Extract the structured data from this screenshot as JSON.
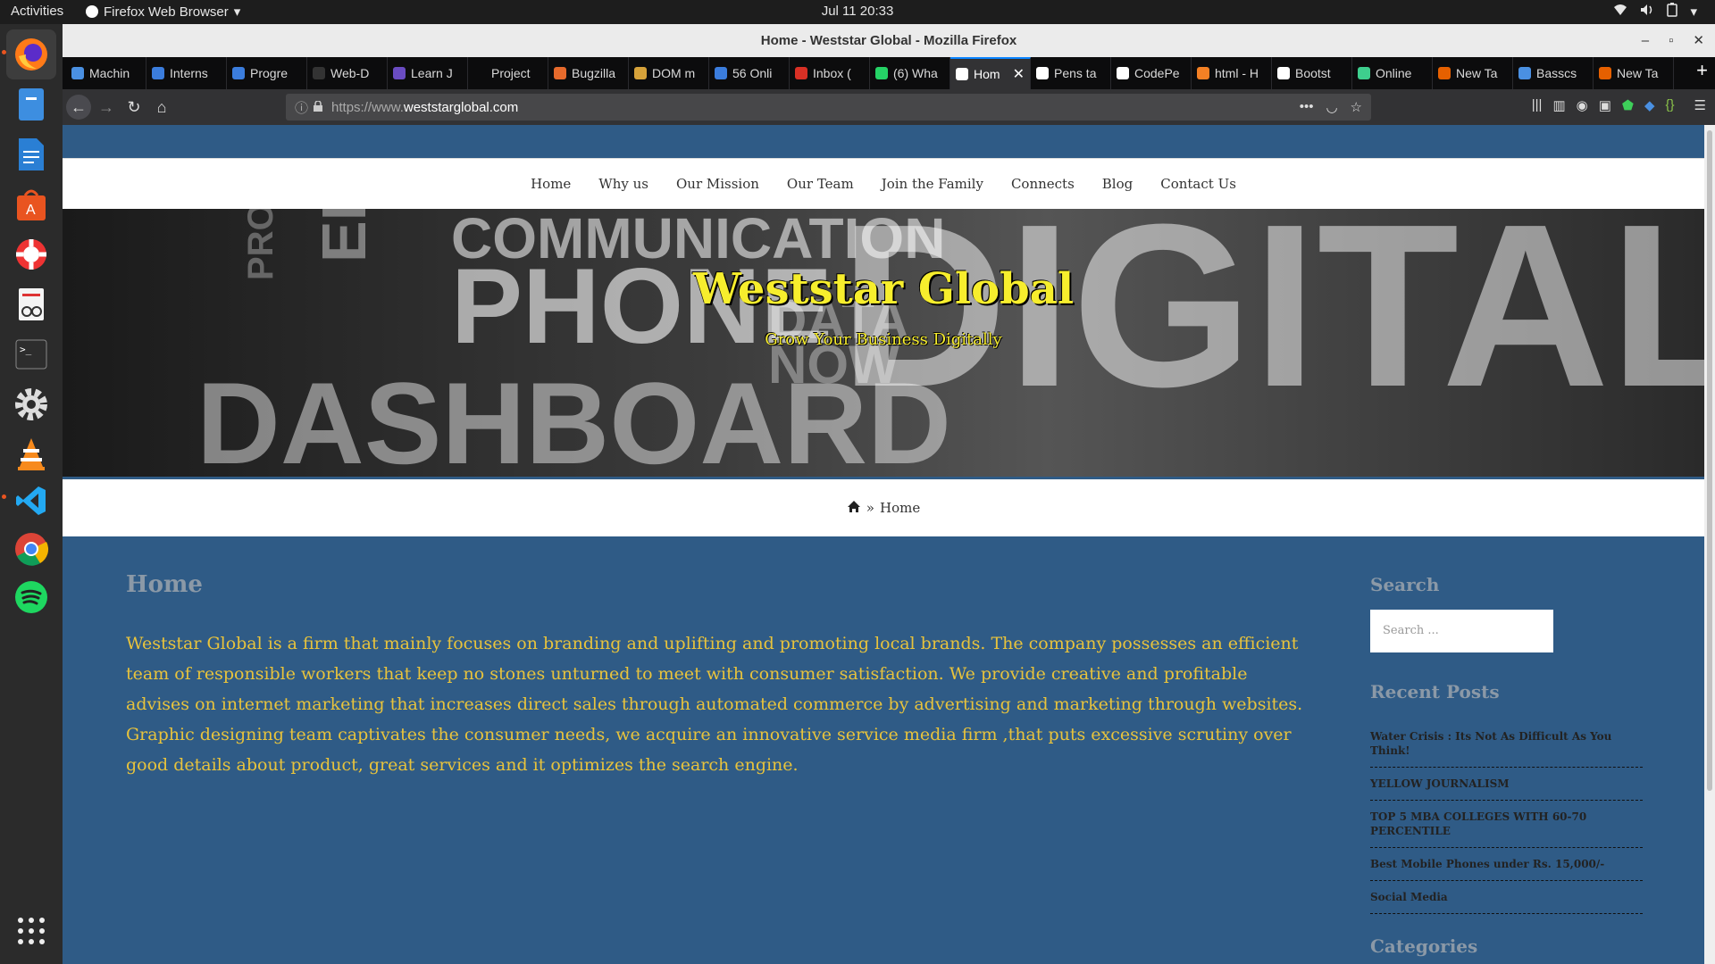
{
  "system": {
    "activities": "Activities",
    "app_menu": "Firefox Web Browser",
    "clock": "Jul 11  20:33"
  },
  "dock": {
    "apps": [
      "firefox-icon",
      "files-icon",
      "writer-icon",
      "software-center-icon",
      "help-icon",
      "document-viewer-icon",
      "terminal-icon",
      "settings-icon",
      "vlc-icon",
      "vscode-icon",
      "chrome-icon",
      "spotify-icon",
      "app-grid-icon"
    ]
  },
  "window": {
    "title": "Home - Weststar Global - Mozilla Firefox"
  },
  "tabs": [
    {
      "label": "Machin",
      "color": "#4a90e2"
    },
    {
      "label": "Interns",
      "color": "#3b7ddd"
    },
    {
      "label": "Progre",
      "color": "#3b7ddd"
    },
    {
      "label": "Web-D",
      "color": "#333333"
    },
    {
      "label": "Learn J",
      "color": "#6a4cc2"
    },
    {
      "label": "Project",
      "color": "#0c0c0d"
    },
    {
      "label": "Bugzilla",
      "color": "#e66a2c"
    },
    {
      "label": "DOM m",
      "color": "#d6a23a"
    },
    {
      "label": "56 Onli",
      "color": "#3b7ddd"
    },
    {
      "label": "Inbox (",
      "color": "#d93025"
    },
    {
      "label": "(6) Wha",
      "color": "#25d366"
    },
    {
      "label": "Hom",
      "color": "#ffffff",
      "active": true
    },
    {
      "label": "Pens ta",
      "color": "#ffffff"
    },
    {
      "label": "CodePe",
      "color": "#ffffff"
    },
    {
      "label": "html - H",
      "color": "#f48024"
    },
    {
      "label": "Bootst",
      "color": "#ffffff"
    },
    {
      "label": "Online",
      "color": "#3ecf8e"
    },
    {
      "label": "New Ta",
      "color": "#e66000"
    },
    {
      "label": "Basscs",
      "color": "#4a90e2"
    },
    {
      "label": "New Ta",
      "color": "#e66000"
    }
  ],
  "url": {
    "scheme": "https://www.",
    "host": "weststarglobal.com"
  },
  "site": {
    "nav": [
      "Home",
      "Why us",
      "Our Mission",
      "Our Team",
      "Join the Family",
      "Connects",
      "Blog",
      "Contact Us"
    ],
    "title": "Weststar Global",
    "tagline": "Grow Your Business Digitally",
    "breadcrumb_sep": "»",
    "breadcrumb_current": "Home",
    "hero_words": [
      "COMMUNICATION",
      "PHONE",
      "DASHBOARD",
      "DIGITAL",
      "DATA",
      "NOW",
      "EMAIL",
      "PRO"
    ]
  },
  "main": {
    "heading": "Home",
    "body": "Weststar Global is a firm that mainly focuses on branding and uplifting and promoting local brands. The company possesses an efficient team of responsible workers that keep no stones unturned to meet with consumer satisfaction. We provide creative and profitable advises on internet marketing that increases direct sales through automated commerce by advertising and marketing through websites. Graphic designing team captivates the consumer needs, we acquire an innovative service media firm ,that puts excessive scrutiny over good details about product, great services and it optimizes the search engine."
  },
  "sidebar": {
    "search_heading": "Search",
    "search_placeholder": "Search ...",
    "recent_heading": "Recent Posts",
    "posts": [
      "Water Crisis : Its Not As Difficult As You Think!",
      "YELLOW JOURNALISM",
      "TOP 5 MBA COLLEGES WITH 60-70 PERCENTILE",
      "Best Mobile Phones under Rs. 15,000/-",
      "Social Media"
    ],
    "categories_heading": "Categories"
  }
}
